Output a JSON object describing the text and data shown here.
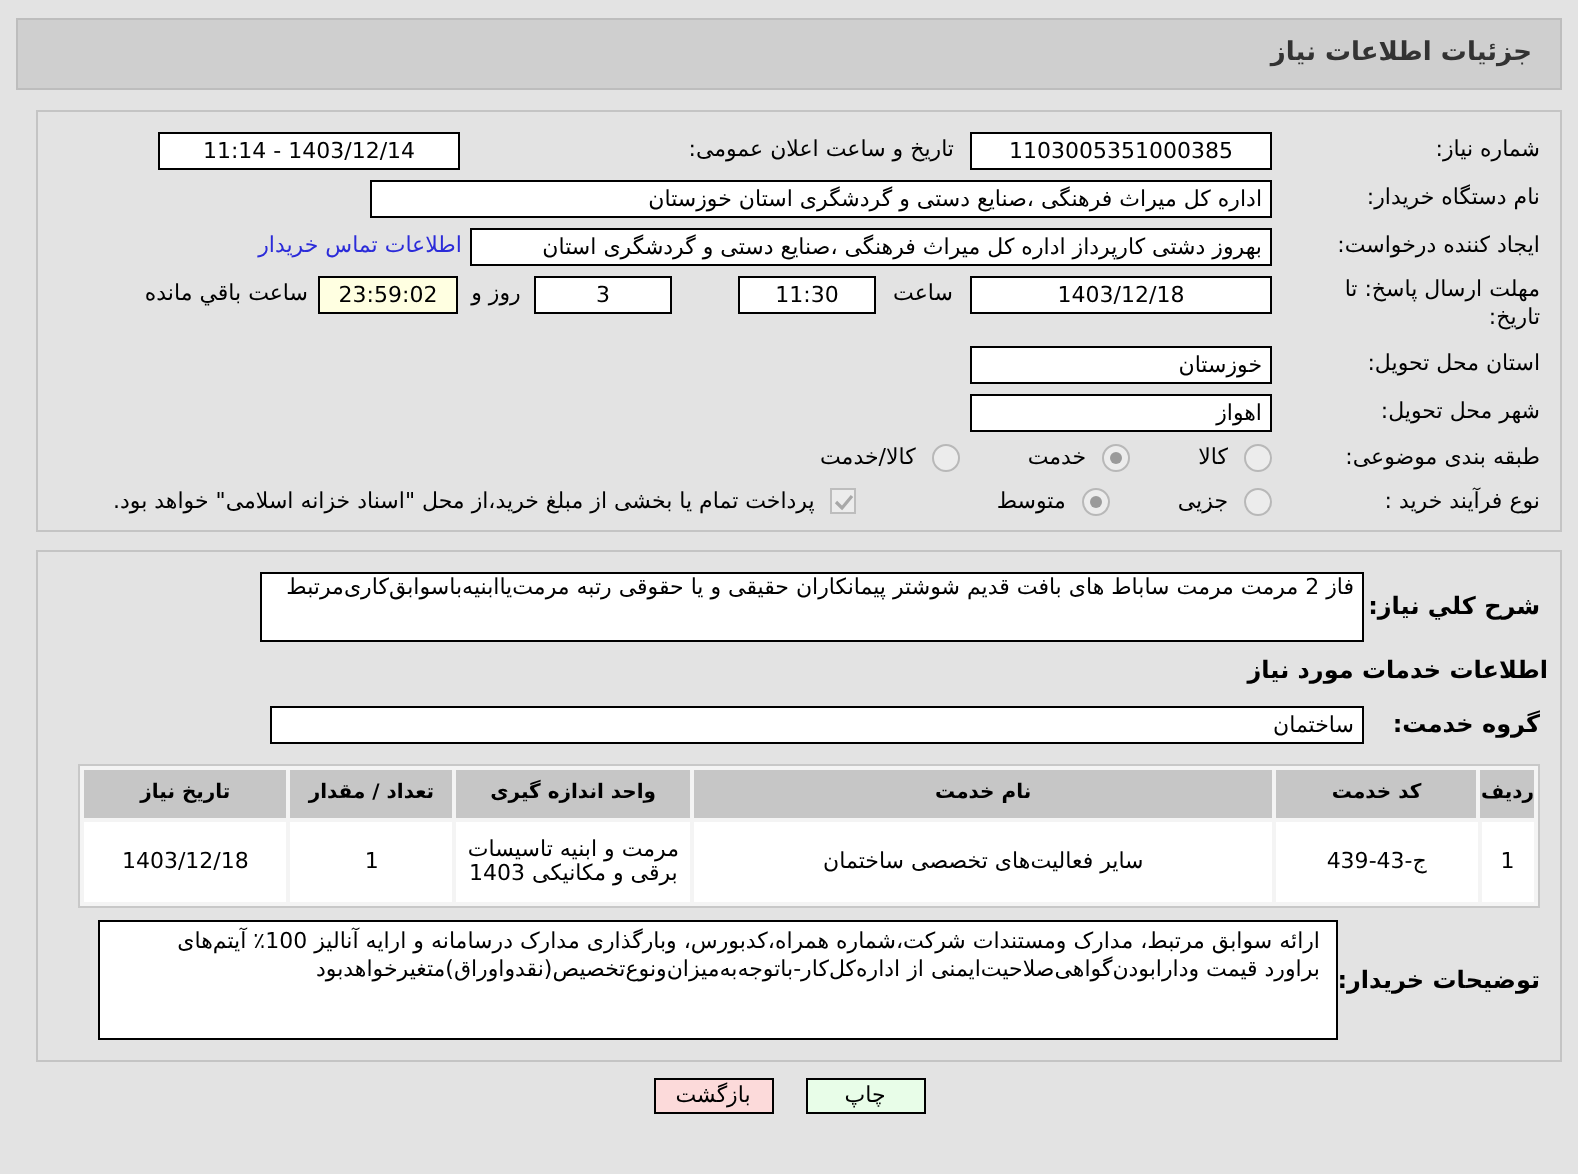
{
  "header": {
    "title": "جزئیات اطلاعات نیاز"
  },
  "need_number": {
    "label": "شماره نیاز:",
    "value": "1103005351000385"
  },
  "announce": {
    "label": "تاریخ و ساعت اعلان عمومی:",
    "value": "1403/12/14 - 11:14"
  },
  "buyer_org": {
    "label": "نام دستگاه خریدار:",
    "value": "اداره کل میراث فرهنگی ،صنایع دستی و گردشگری استان خوزستان"
  },
  "requester": {
    "label": "ایجاد کننده درخواست:",
    "value": "بهروز دشتی کارپرداز اداره کل میراث فرهنگی ،صنایع دستی و گردشگری استان",
    "contact_link": "اطلاعات تماس خریدار"
  },
  "deadline": {
    "label": "مهلت ارسال پاسخ: تا تاریخ:",
    "date": "1403/12/18",
    "time_label": "ساعت",
    "time": "11:30",
    "days": "3",
    "days_label": "روز و",
    "remaining": "23:59:02",
    "remaining_label": "ساعت باقي مانده"
  },
  "province": {
    "label": "استان محل تحویل:",
    "value": "خوزستان"
  },
  "city": {
    "label": "شهر محل تحویل:",
    "value": "اهواز"
  },
  "category": {
    "label": "طبقه بندی موضوعی:",
    "options": [
      {
        "label": "کالا",
        "selected": false
      },
      {
        "label": "خدمت",
        "selected": true
      },
      {
        "label": "کالا/خدمت",
        "selected": false
      }
    ]
  },
  "purchase_type": {
    "label": "نوع فرآیند خرید :",
    "options": [
      {
        "label": "جزیی",
        "selected": false
      },
      {
        "label": "متوسط",
        "selected": true
      }
    ],
    "payment": {
      "label": "پرداخت تمام یا بخشی از مبلغ خرید،از محل \"اسناد خزانه اسلامی\" خواهد بود.",
      "checked": true
    }
  },
  "description": {
    "label": "شرح کلي نیاز:",
    "value": "فاز 2 مرمت مرمت ساباط های بافت قدیم شوشتر پیمانکاران حقیقی و یا حقوقی رتبه مرمت‌یاابنیه‌باسوابق‌کاری‌مرتبط"
  },
  "services_title": "اطلاعات خدمات مورد نیاز",
  "service_group": {
    "label": "گروه خدمت:",
    "value": "ساختمان"
  },
  "table": {
    "columns": [
      "ردیف",
      "کد خدمت",
      "نام خدمت",
      "واحد اندازه گیری",
      "تعداد / مقدار",
      "تاریخ نیاز"
    ],
    "rows": [
      [
        "1",
        "ج-43-439",
        "سایر فعالیت‌های تخصصی ساختمان",
        "مرمت و ابنیه تاسیسات برقی و مکانیکی 1403",
        "1",
        "1403/12/18"
      ]
    ]
  },
  "buyer_notes": {
    "label": "توضیحات خریدار:",
    "value": "ارائه سوابق مرتبط، مدارک ومستندات شرکت،شماره همراه،کدبورس، وبارگذاری مدارک درسامانه و ارایه آنالیز 100٪ آیتم‌های براورد قیمت ودارابودن‌گواهی‌صلاحیت‌ایمنی از اداره‌کل‌کار-باتوجه‌به‌میزان‌ونوع‌تخصیص(نقدواوراق)متغیرخواهدبود"
  },
  "buttons": [
    {
      "label": "چاپ",
      "kind": "print"
    },
    {
      "label": "بازگشت",
      "kind": "back"
    }
  ]
}
